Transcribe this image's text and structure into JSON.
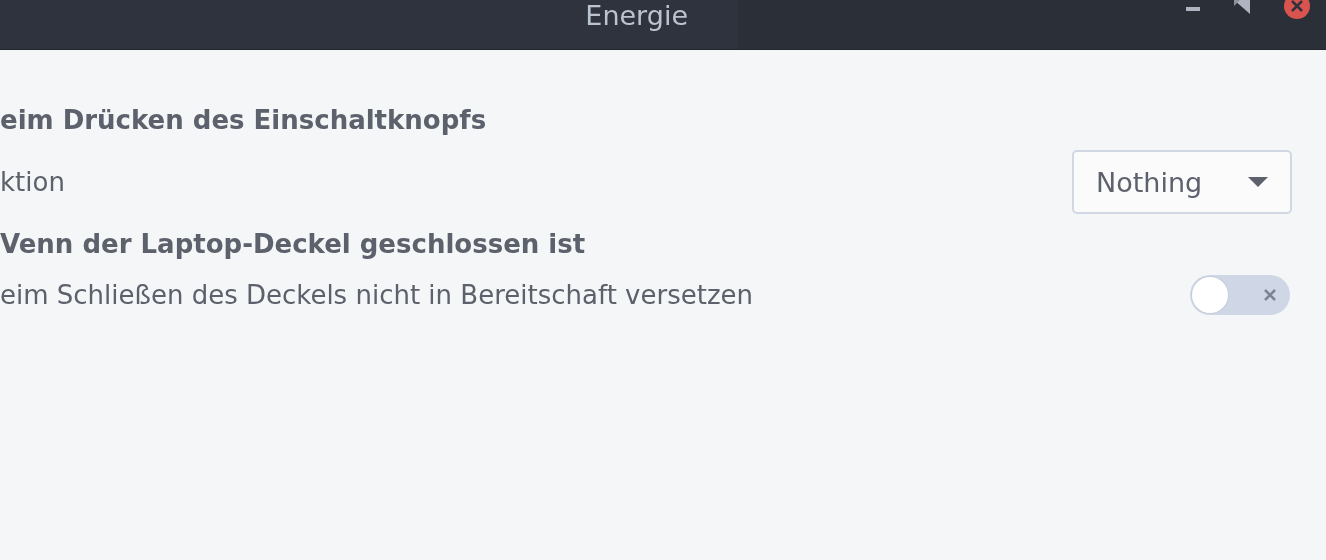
{
  "window": {
    "title": "Energie"
  },
  "sections": [
    {
      "heading": "eim Drücken des Einschaltknopfs",
      "rows": [
        {
          "kind": "dropdown",
          "label": "ktion",
          "value": "Nothing"
        }
      ]
    },
    {
      "heading": "Venn der Laptop-Deckel geschlossen ist",
      "rows": [
        {
          "kind": "switch",
          "label": "eim Schließen des Deckels nicht in Bereitschaft versetzen",
          "on": false
        }
      ]
    }
  ]
}
